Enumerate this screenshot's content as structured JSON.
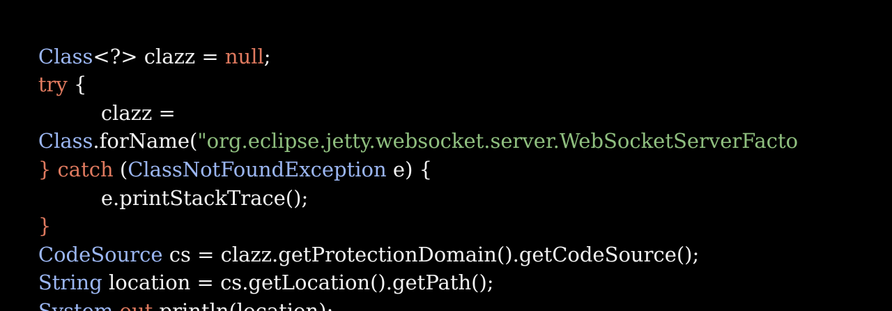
{
  "colors": {
    "background": "#000000",
    "plain": "#f2f2f2",
    "type": "#9bb6f2",
    "keyword": "#e07a5f",
    "string": "#8fbf7f"
  },
  "code": {
    "l1": {
      "t1": "Class",
      "t2": "<?> clazz = ",
      "t3": "null",
      "t4": ";"
    },
    "l2": {
      "t1": "try",
      "t2": " {"
    },
    "l3": {
      "t1": "clazz ="
    },
    "l4": {
      "t1": "Class",
      "t2": ".forName(",
      "t3": "\"org.eclipse.jetty.websocket.server.WebSocketServerFacto"
    },
    "l5": {
      "t1": "}",
      "t2": " catch",
      "t3": " (",
      "t4": "ClassNotFoundException",
      "t5": " e) {"
    },
    "l6": {
      "t1": "e.printStackTrace();"
    },
    "l7": {
      "t1": "}"
    },
    "l8": {
      "t1": "CodeSource",
      "t2": " cs = clazz.getProtectionDomain().getCodeSource();"
    },
    "l9": {
      "t1": "String",
      "t2": " location = cs.getLocation().getPath();"
    },
    "l10": {
      "t1": "System",
      "t2": ".",
      "t3": "out",
      "t4": ".println(location);"
    }
  }
}
